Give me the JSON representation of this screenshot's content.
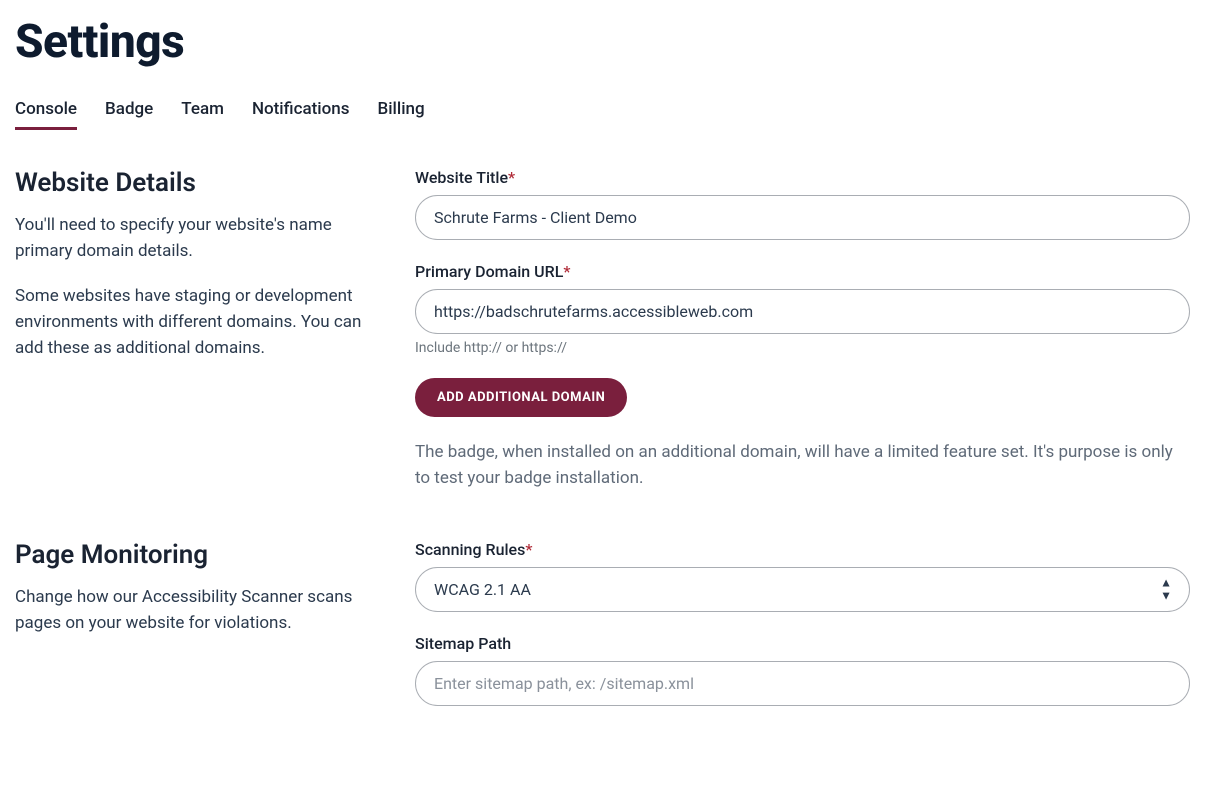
{
  "page": {
    "title": "Settings"
  },
  "tabs": {
    "items": [
      {
        "label": "Console",
        "active": true
      },
      {
        "label": "Badge",
        "active": false
      },
      {
        "label": "Team",
        "active": false
      },
      {
        "label": "Notifications",
        "active": false
      },
      {
        "label": "Billing",
        "active": false
      }
    ]
  },
  "websiteDetails": {
    "title": "Website Details",
    "desc1": "You'll need to specify your website's name primary domain details.",
    "desc2": "Some websites have staging or development environments with different domains. You can add these as additional domains.",
    "websiteTitleLabel": "Website Title",
    "websiteTitleValue": "Schrute Farms - Client Demo",
    "primaryDomainLabel": "Primary Domain URL",
    "primaryDomainValue": "https://badschrutefarms.accessibleweb.com",
    "primaryDomainHint": "Include http:// or https://",
    "addDomainButton": "Add Additional Domain",
    "badgeInfo": "The badge, when installed on an additional domain, will have a limited feature set. It's purpose is only to test your badge installation."
  },
  "pageMonitoring": {
    "title": "Page Monitoring",
    "desc": "Change how our Accessibility Scanner scans pages on your website for violations.",
    "scanningRulesLabel": "Scanning Rules",
    "scanningRulesValue": "WCAG 2.1 AA",
    "sitemapLabel": "Sitemap Path",
    "sitemapPlaceholder": "Enter sitemap path, ex: /sitemap.xml"
  }
}
